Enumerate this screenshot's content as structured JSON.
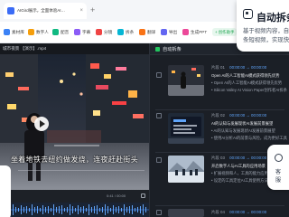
{
  "browser": {
    "tab_title": "AIGird展示，全面体验AI…",
    "tab_close": "×",
    "new_tab": "+"
  },
  "toolbar": {
    "items": [
      {
        "label": "素材库",
        "color": "#3b82f6"
      },
      {
        "label": "数字人",
        "color": "#f59e0b"
      },
      {
        "label": "配音",
        "color": "#10b981"
      },
      {
        "label": "字幕",
        "color": "#8b5cf6"
      },
      {
        "label": "分镜",
        "color": "#ef4444"
      },
      {
        "label": "拆条",
        "color": "#06b6d4"
      },
      {
        "label": "翻译",
        "color": "#f97316"
      },
      {
        "label": "导出",
        "color": "#6366f1"
      },
      {
        "label": "生成PPT",
        "color": "#ec4899"
      }
    ],
    "badge": "+ 创作助手"
  },
  "video": {
    "title": "城市夜景 【演示】.mp4",
    "subtitle": "坐着地铁去纽约做发烧，连夜赶赴街头",
    "time": "0:41 / 00:00"
  },
  "clip_panel": {
    "title": "自动拆条",
    "segments": [
      {
        "label": "片段 01",
        "time": "00:00:00 → 00:00:00",
        "lines": [
          "Open AI的人工智能AI模式获得领先优势",
          "• Open AI的人工智能AI模式获得领先优势",
          "• Silicon Valley AI Vision Paper创作者AI拆条优势"
        ]
      },
      {
        "label": "片段 02",
        "time": "00:00:00 → 00:00:00",
        "lines": [
          "AI的认知与发展现状AI发展前景展望",
          "• AI的认知与发展现状AI发展前景展望",
          "• 使用AI分析AI的前景与风险，成为更好工具"
        ]
      },
      {
        "label": "片段 03",
        "time": "00:00:00 → 00:00:00",
        "lines": [
          "开启数字人与AI工具的应用场景",
          "• 扩展视频和人，工具的能力应用场景",
          "• 设定的工具定位AI工具使用方法AI应用场景"
        ]
      },
      {
        "label": "片段 04",
        "time": "00:00:00 → 00:00:00",
        "lines": []
      }
    ]
  },
  "tooltip": {
    "title": "自动拆条",
    "lines": [
      "基于视频内容，自",
      "条短视频，实现快"
    ]
  },
  "fab": {
    "lines": [
      "客",
      "服"
    ]
  },
  "colors": {
    "accent": "#22c55e",
    "time": "#60a5fa",
    "panel": "#1b1f26"
  }
}
